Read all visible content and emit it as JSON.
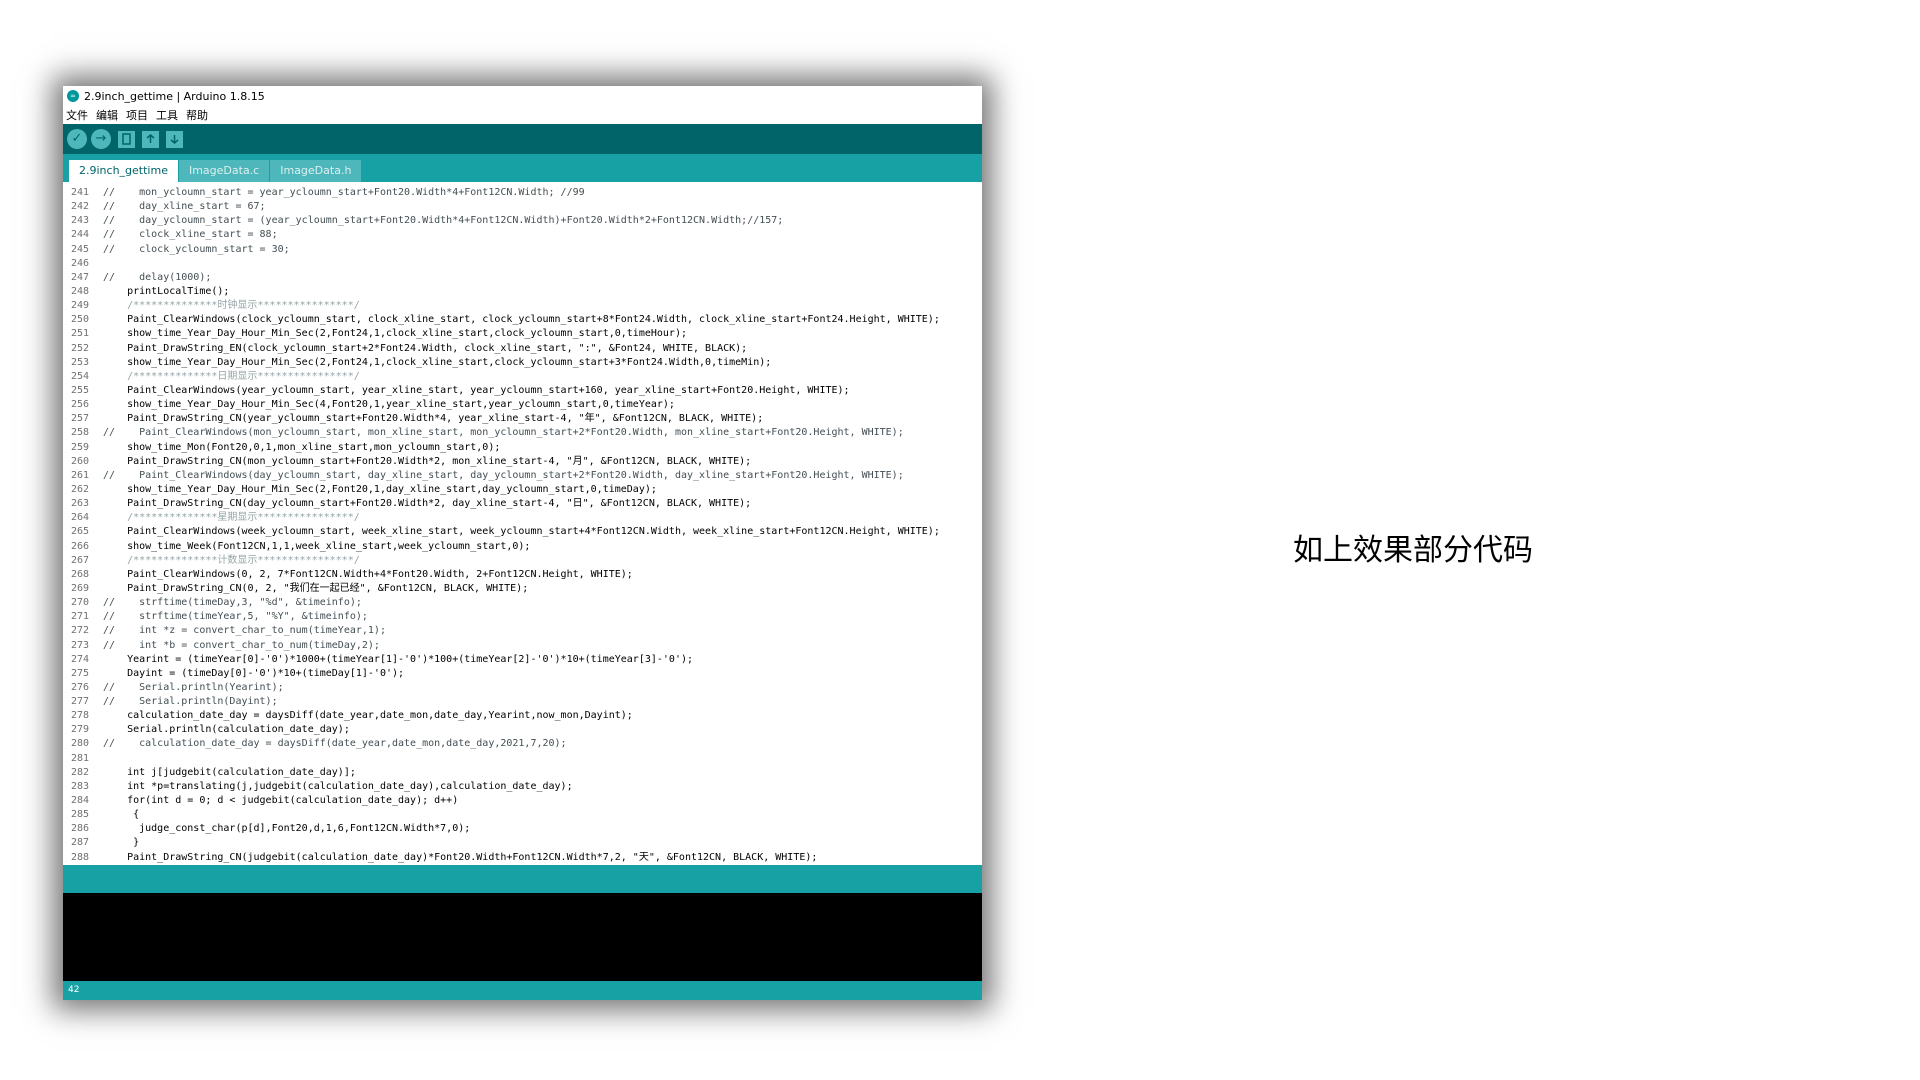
{
  "window": {
    "title": "2.9inch_gettime | Arduino 1.8.15"
  },
  "menu": [
    "文件",
    "编辑",
    "项目",
    "工具",
    "帮助"
  ],
  "toolbar": {
    "verify_icon": "✓",
    "upload_icon": "→",
    "new_icon": "new-file-icon",
    "open_icon": "open-icon",
    "save_icon": "save-icon"
  },
  "tabs": [
    "2.9inch_gettime",
    "ImageData.c",
    "ImageData.h"
  ],
  "editor": {
    "line_numbers": [
      "241",
      "242",
      "243",
      "244",
      "245",
      "246",
      "247",
      "248",
      "249",
      "250",
      "251",
      "252",
      "253",
      "254",
      "255",
      "256",
      "257",
      "258",
      "259",
      "260",
      "261",
      "262",
      "263",
      "264",
      "265",
      "266",
      "267",
      "268",
      "269",
      "270",
      "271",
      "272",
      "273",
      "274",
      "275",
      "276",
      "277",
      "278",
      "279",
      "280",
      "281",
      "282",
      "283",
      "284",
      "285",
      "286",
      "287",
      "288"
    ],
    "lines": [
      "//    mon_ycloumn_start = year_ycloumn_start+Font20.Width*4+Font12CN.Width; //99",
      "//    day_xline_start = 67;",
      "//    day_ycloumn_start = (year_ycloumn_start+Font20.Width*4+Font12CN.Width)+Font20.Width*2+Font12CN.Width;//157;",
      "//    clock_xline_start = 88;",
      "//    clock_ycloumn_start = 30;",
      "",
      "//    delay(1000);",
      "    printLocalTime();",
      "    /**************时钟显示****************/",
      "    Paint_ClearWindows(clock_ycloumn_start, clock_xline_start, clock_ycloumn_start+8*Font24.Width, clock_xline_start+Font24.Height, WHITE);",
      "    show_time_Year_Day_Hour_Min_Sec(2,Font24,1,clock_xline_start,clock_ycloumn_start,0,timeHour);",
      "    Paint_DrawString_EN(clock_ycloumn_start+2*Font24.Width, clock_xline_start, \":\", &Font24, WHITE, BLACK);",
      "    show_time_Year_Day_Hour_Min_Sec(2,Font24,1,clock_xline_start,clock_ycloumn_start+3*Font24.Width,0,timeMin);",
      "    /**************日期显示****************/",
      "    Paint_ClearWindows(year_ycloumn_start, year_xline_start, year_ycloumn_start+160, year_xline_start+Font20.Height, WHITE);",
      "    show_time_Year_Day_Hour_Min_Sec(4,Font20,1,year_xline_start,year_ycloumn_start,0,timeYear);",
      "    Paint_DrawString_CN(year_ycloumn_start+Font20.Width*4, year_xline_start-4, \"年\", &Font12CN, BLACK, WHITE);",
      "//    Paint_ClearWindows(mon_ycloumn_start, mon_xline_start, mon_ycloumn_start+2*Font20.Width, mon_xline_start+Font20.Height, WHITE);",
      "    show_time_Mon(Font20,0,1,mon_xline_start,mon_ycloumn_start,0);",
      "    Paint_DrawString_CN(mon_ycloumn_start+Font20.Width*2, mon_xline_start-4, \"月\", &Font12CN, BLACK, WHITE);",
      "//    Paint_ClearWindows(day_ycloumn_start, day_xline_start, day_ycloumn_start+2*Font20.Width, day_xline_start+Font20.Height, WHITE);",
      "    show_time_Year_Day_Hour_Min_Sec(2,Font20,1,day_xline_start,day_ycloumn_start,0,timeDay);",
      "    Paint_DrawString_CN(day_ycloumn_start+Font20.Width*2, day_xline_start-4, \"日\", &Font12CN, BLACK, WHITE);",
      "    /**************星期显示****************/",
      "    Paint_ClearWindows(week_ycloumn_start, week_xline_start, week_ycloumn_start+4*Font12CN.Width, week_xline_start+Font12CN.Height, WHITE);",
      "    show_time_Week(Font12CN,1,1,week_xline_start,week_ycloumn_start,0);",
      "    /**************计数显示****************/",
      "    Paint_ClearWindows(0, 2, 7*Font12CN.Width+4*Font20.Width, 2+Font12CN.Height, WHITE);",
      "    Paint_DrawString_CN(0, 2, \"我们在一起已经\", &Font12CN, BLACK, WHITE);",
      "//    strftime(timeDay,3, \"%d\", &timeinfo);",
      "//    strftime(timeYear,5, \"%Y\", &timeinfo);",
      "//    int *z = convert_char_to_num(timeYear,1);",
      "//    int *b = convert_char_to_num(timeDay,2);",
      "    Yearint = (timeYear[0]-'0')*1000+(timeYear[1]-'0')*100+(timeYear[2]-'0')*10+(timeYear[3]-'0');",
      "    Dayint = (timeDay[0]-'0')*10+(timeDay[1]-'0');",
      "//    Serial.println(Yearint);",
      "//    Serial.println(Dayint);",
      "    calculation_date_day = daysDiff(date_year,date_mon,date_day,Yearint,now_mon,Dayint);",
      "    Serial.println(calculation_date_day);",
      "//    calculation_date_day = daysDiff(date_year,date_mon,date_day,2021,7,20);",
      "",
      "    int j[judgebit(calculation_date_day)];",
      "    int *p=translating(j,judgebit(calculation_date_day),calculation_date_day);",
      "    for(int d = 0; d < judgebit(calculation_date_day); d++)",
      "     {",
      "      judge_const_char(p[d],Font20,d,1,6,Font12CN.Width*7,0);",
      "     }",
      "    Paint_DrawString_CN(judgebit(calculation_date_day)*Font20.Width+Font12CN.Width*7,2, \"天\", &Font12CN, BLACK, WHITE);"
    ]
  },
  "status": {
    "line_number": "42"
  },
  "caption": "如上效果部分代码"
}
